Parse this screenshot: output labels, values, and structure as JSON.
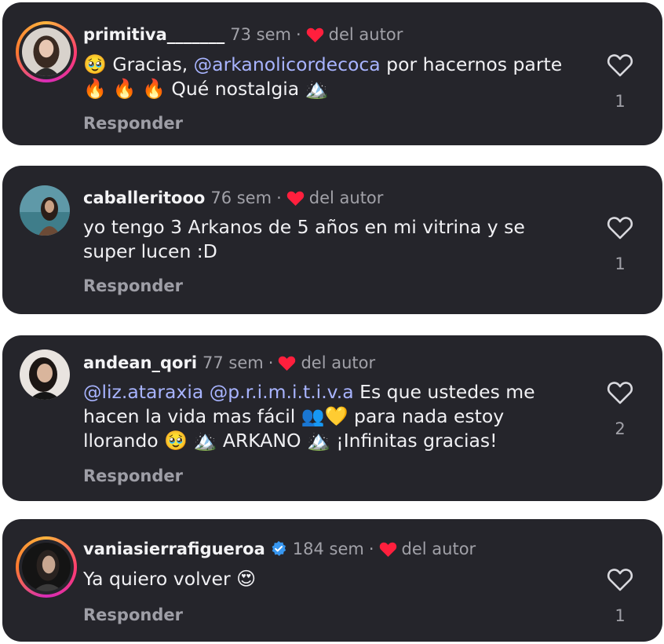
{
  "comments": [
    {
      "username": "primitiva_______",
      "time": "73 sem",
      "separator": "·",
      "author_label": "del autor",
      "text_parts": {
        "emoji_a": "🥹",
        "p1": " Gracias, ",
        "mention1": "@arkanolicordecoca",
        "p2": " por hacernos parte ",
        "emoji_b": "🔥 🔥 🔥",
        "p3": " Qué nostalgia ",
        "emoji_c": "🏔️"
      },
      "reply_label": "Responder",
      "likes": "1"
    },
    {
      "username": "caballeritooo",
      "time": "76 sem",
      "separator": "·",
      "author_label": "del autor",
      "text": "yo tengo 3 Arkanos de 5 años en mi vitrina y se super lucen :D",
      "reply_label": "Responder",
      "likes": "1"
    },
    {
      "username": "andean_qori",
      "time": "77 sem",
      "separator": "·",
      "author_label": "del autor",
      "text_parts": {
        "mention1": "@liz.ataraxia",
        "sp": " ",
        "mention2": "@p.r.i.m.i.t.i.v.a",
        "p1": " Es que ustedes me hacen la vida mas fácil ",
        "emoji_a": "👥💛",
        "p2": " para nada estoy llorando ",
        "emoji_b": "🥹",
        "p3": " ",
        "emoji_c": "🏔️",
        "p4": " ARKANO ",
        "emoji_d": "🏔️",
        "p5": " ¡Infinitas gracias!"
      },
      "reply_label": "Responder",
      "likes": "2"
    },
    {
      "username": "vaniasierrafigueroa",
      "time": "184 sem",
      "separator": "·",
      "author_label": "del autor",
      "text_parts": {
        "p1": "Ya quiero volver ",
        "emoji_a": "😍"
      },
      "reply_label": "Responder",
      "likes": "1"
    }
  ],
  "icons": {
    "like": "heart-outline-icon",
    "author_like": "heart-filled-icon",
    "verified": "verified-badge-icon"
  },
  "colors": {
    "card_bg": "#25252b",
    "author_heart": "#ff1f3d",
    "mention": "#a8b4ff",
    "verified": "#3897f0"
  }
}
